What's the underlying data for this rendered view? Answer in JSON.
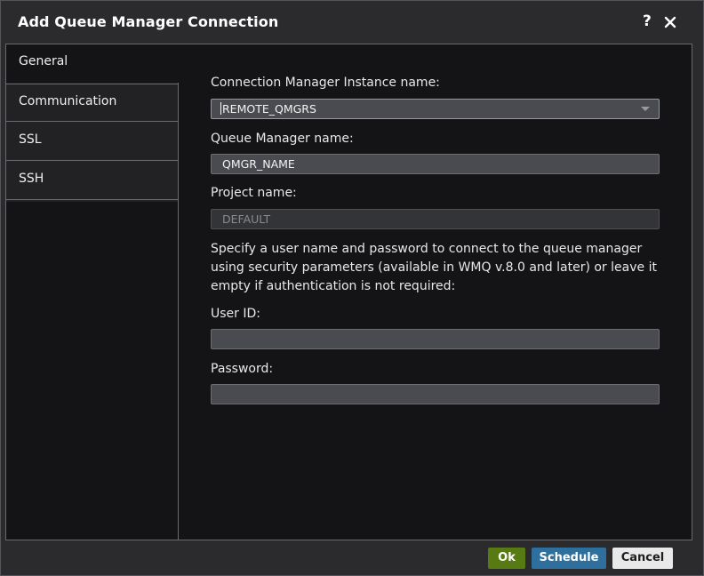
{
  "dialog": {
    "title": "Add Queue Manager Connection",
    "help_icon": "?",
    "close_icon": "close-icon"
  },
  "sidebar": {
    "items": [
      {
        "label": "General",
        "active": true
      },
      {
        "label": "Communication",
        "active": false
      },
      {
        "label": "SSL",
        "active": false
      },
      {
        "label": "SSH",
        "active": false
      }
    ]
  },
  "form": {
    "instance_label": "Connection Manager Instance name:",
    "instance_value": "REMOTE_QMGRS",
    "qmgr_label": "Queue Manager name:",
    "qmgr_value": "QMGR_NAME",
    "project_label": "Project name:",
    "project_value": "DEFAULT",
    "description": "Specify a user name and password to connect to the queue manager using security parameters (available in WMQ v.8.0 and later) or leave it empty if authentication is not required:",
    "userid_label": "User ID:",
    "userid_value": "",
    "password_label": "Password:",
    "password_value": ""
  },
  "buttons": {
    "ok": "Ok",
    "schedule": "Schedule",
    "cancel": "Cancel"
  },
  "colors": {
    "ok": "#577a12",
    "schedule": "#2e6f9e",
    "cancel": "#e9e9ea",
    "select_focus_border": "#7d9ec7"
  }
}
